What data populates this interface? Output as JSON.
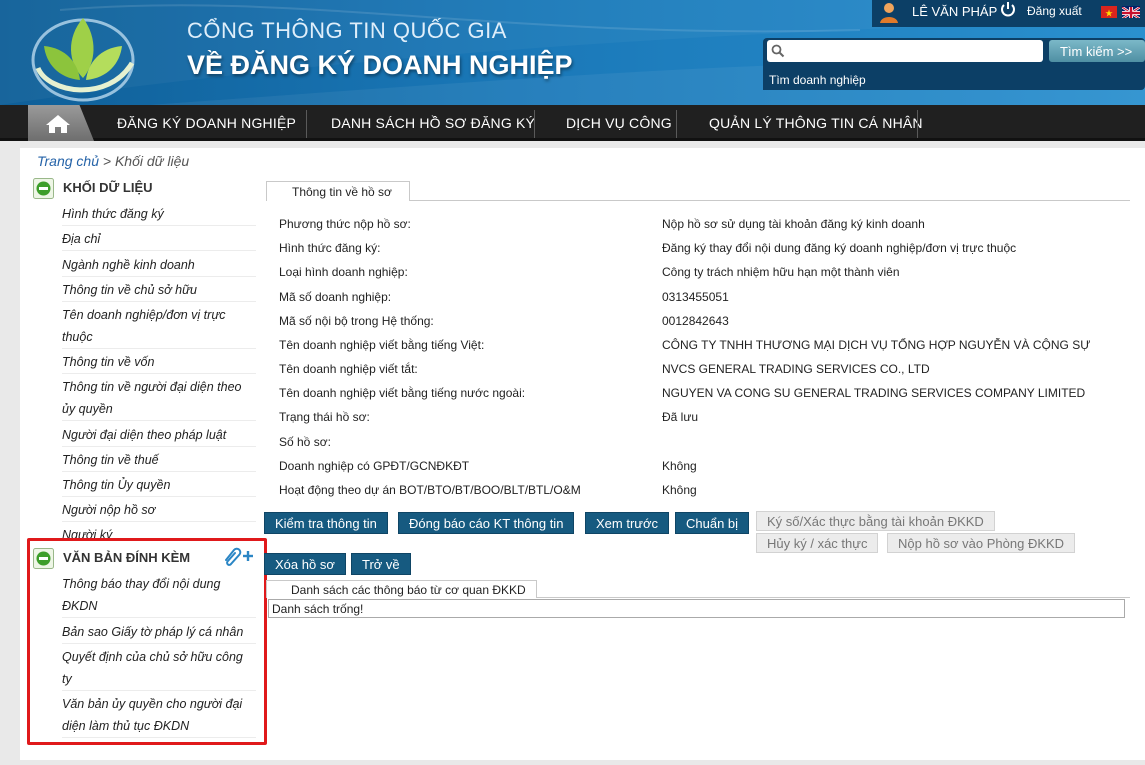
{
  "header": {
    "title_line1": "CỔNG THÔNG TIN QUỐC GIA",
    "title_line2": "VỀ ĐĂNG KÝ DOANH NGHIỆP",
    "user_name": "LÊ VĂN PHÁP",
    "logout_label": "Đăng xuất",
    "search_placeholder": "",
    "search_button": "Tìm kiếm >>",
    "search_hint": "Tìm doanh nghiệp"
  },
  "nav": {
    "items": [
      "ĐĂNG KÝ DOANH NGHIỆP",
      "DANH SÁCH HỒ SƠ ĐĂNG KÝ",
      "DỊCH VỤ CÔNG",
      "QUẢN LÝ THÔNG TIN CÁ NHÂN"
    ]
  },
  "breadcrumb": {
    "home": "Trang chủ",
    "separator": " > ",
    "current": "Khối dữ liệu"
  },
  "sidebar": {
    "data_title": "KHỐI DỮ LIỆU",
    "data_items": [
      "Hình thức đăng ký",
      "Địa chỉ",
      "Ngành nghề kinh doanh",
      "Thông tin về chủ sở hữu",
      "Tên doanh nghiệp/đơn vị trực thuộc",
      "Thông tin về vốn",
      "Thông tin về người đại diện theo ủy quyền",
      "Người đại diện theo pháp luật",
      "Thông tin về thuế",
      "Thông tin Ủy quyền",
      "Người nộp hồ sơ",
      "Người ký"
    ],
    "attach_title": "VĂN BẢN ĐÍNH KÈM",
    "attach_items": [
      "Thông báo thay đổi nội dung ĐKDN",
      "Bản sao Giấy tờ pháp lý cá nhân",
      "Quyết định của chủ sở hữu công ty",
      "Văn bản ủy quyền cho người đại diện làm thủ tục ĐKDN"
    ]
  },
  "panel": {
    "tab_title": "Thông tin về hồ sơ",
    "rows": [
      {
        "label": "Phương thức nộp hồ sơ:",
        "value": "Nộp hồ sơ sử dụng tài khoản đăng ký kinh doanh"
      },
      {
        "label": "Hình thức đăng ký:",
        "value": "Đăng ký thay đổi nội dung đăng ký doanh nghiệp/đơn vị trực thuộc"
      },
      {
        "label": "Loại hình doanh nghiệp:",
        "value": "Công ty trách nhiệm hữu hạn một thành viên"
      },
      {
        "label": "Mã số doanh nghiệp:",
        "value": "0313455051"
      },
      {
        "label": "Mã số nội bộ trong Hệ thống:",
        "value": "0012842643"
      },
      {
        "label": "Tên doanh nghiệp viết bằng tiếng Việt:",
        "value": "CÔNG TY TNHH THƯƠNG MẠI DỊCH VỤ TỔNG HỢP NGUYỄN VÀ CỘNG SỰ"
      },
      {
        "label": "Tên doanh nghiệp viết tắt:",
        "value": "NVCS GENERAL TRADING SERVICES CO., LTD"
      },
      {
        "label": "Tên doanh nghiệp viết bằng tiếng nước ngoài:",
        "value": "NGUYEN VA CONG SU GENERAL TRADING SERVICES COMPANY LIMITED"
      },
      {
        "label": "Trạng thái hồ sơ:",
        "value": "Đã lưu"
      },
      {
        "label": "Số hồ sơ:",
        "value": ""
      },
      {
        "label": "Doanh nghiệp có GPĐT/GCNĐKĐT",
        "value": "Không"
      },
      {
        "label": "Hoạt động theo dự án BOT/BTO/BT/BOO/BLT/BTL/O&M",
        "value": "Không"
      }
    ]
  },
  "buttons": {
    "check": "Kiểm tra thông tin",
    "package": "Đóng báo cáo KT thông tin",
    "preview": "Xem trước",
    "ready": "Chuẩn bị",
    "sign": "Ký số/Xác thực bằng tài khoản ĐKKD",
    "cancel_sign": "Hủy ký / xác thực",
    "submit": "Nộp hồ sơ vào Phòng ĐKKD",
    "delete": "Xóa hồ sơ",
    "back": "Trở về"
  },
  "notices": {
    "tab_title": "Danh sách các thông báo từ cơ quan ĐKKD",
    "empty_text": "Danh sách trống!"
  },
  "colors": {
    "header_blue": "#1a78b8",
    "navbar": "#202020",
    "button": "#165a80",
    "highlight_box": "#e0191b"
  }
}
